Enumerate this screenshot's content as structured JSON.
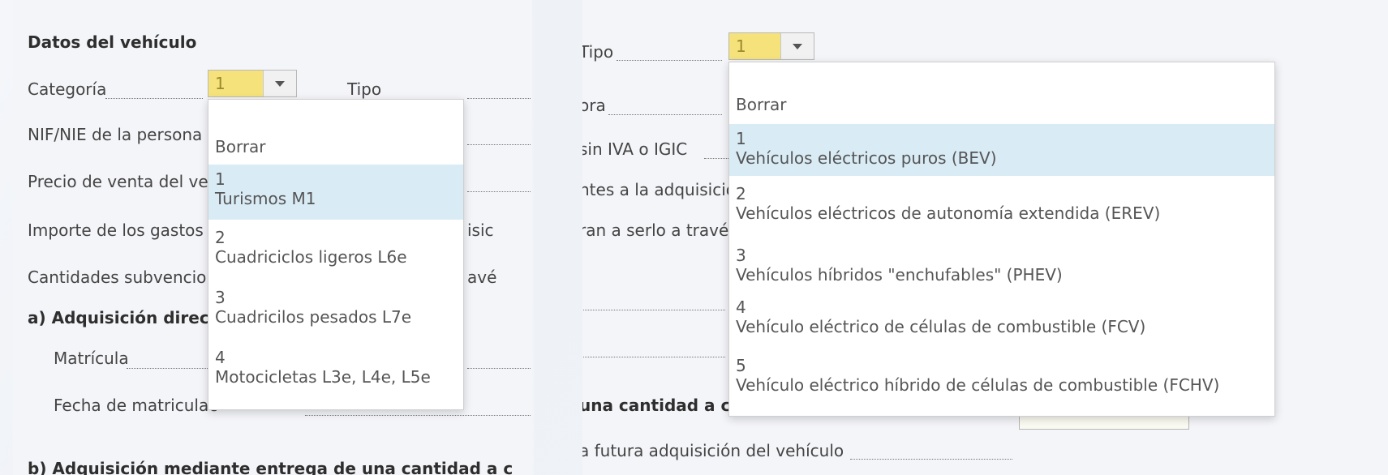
{
  "left": {
    "section_title": "Datos del vehículo",
    "categoria_label": "Categoría",
    "categoria_value": "1",
    "tipo_label": "Tipo",
    "nif_label": "NIF/NIE de la persona",
    "precio_label": "Precio de venta del ve",
    "importe_label": "Importe de los gastos",
    "importe_tail": "isic",
    "cantidades_label": "Cantidades subvencio",
    "cantidades_tail": "avé",
    "adq_directa_label": "a) Adquisición direct",
    "matricula_label": "Matrícula",
    "fecha_label": "Fecha de matriculac",
    "adq_entrega_label": "b) Adquisición mediante entrega de una cantidad a c",
    "dropdown": {
      "clear": "Borrar",
      "options": [
        {
          "num": "1",
          "label": "Turismos M1"
        },
        {
          "num": "2",
          "label": "Cuadriciclos ligeros L6e"
        },
        {
          "num": "3",
          "label": "Cuadricilos pesados L7e"
        },
        {
          "num": "4",
          "label": "Motocicletas L3e, L4e, L5e"
        }
      ]
    }
  },
  "right": {
    "tipo_label": "Tipo",
    "tipo_value": "1",
    "ora_label": "ora",
    "sin_iva_label": "sin IVA o IGIC",
    "ntes_label": "ntes a la adquisición c",
    "ran_label": "ran a serlo a través de",
    "cantidad_label": "una cantidad a cuent",
    "futura_label": "a futura adquisición del vehículo",
    "dropdown": {
      "clear": "Borrar",
      "options": [
        {
          "num": "1",
          "label": "Vehículos eléctricos puros (BEV)"
        },
        {
          "num": "2",
          "label": "Vehículos eléctricos de autonomía extendida (EREV)"
        },
        {
          "num": "3",
          "label": "Vehículos híbridos \"enchufables\" (PHEV)"
        },
        {
          "num": "4",
          "label": "Vehículo eléctrico de células de combustible (FCV)"
        },
        {
          "num": "5",
          "label": "Vehículo eléctrico híbrido de células de combustible (FCHV)"
        }
      ]
    }
  }
}
